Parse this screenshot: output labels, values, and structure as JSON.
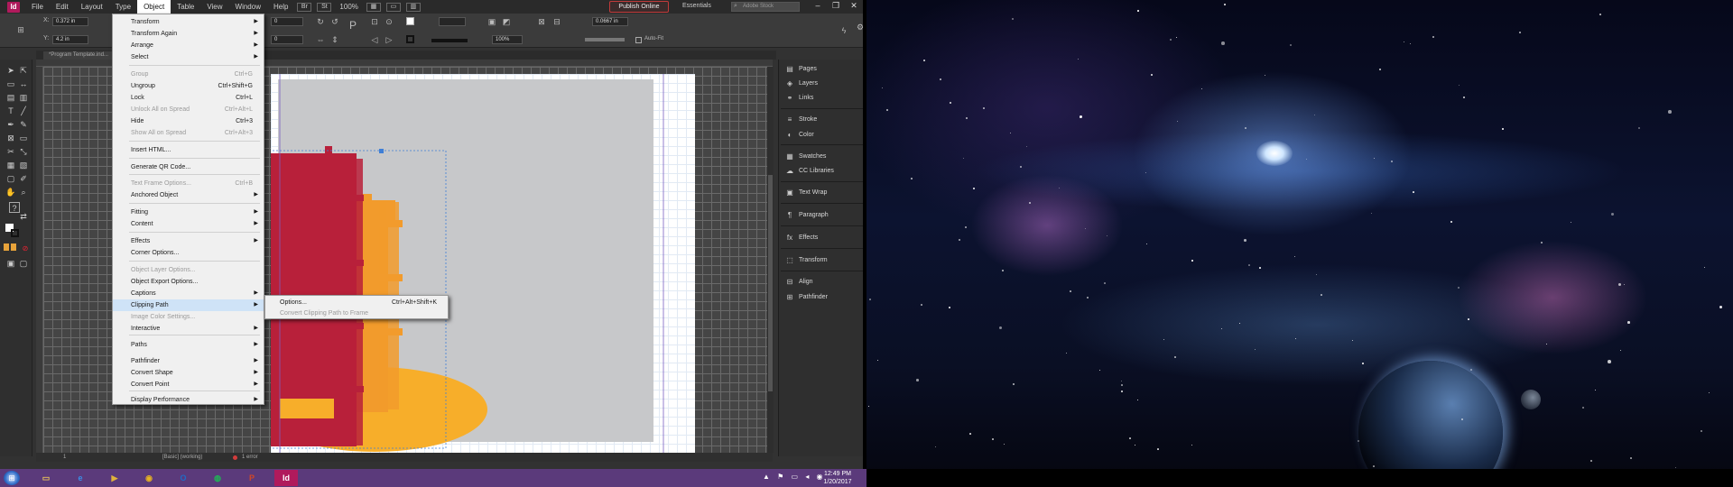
{
  "app": {
    "logo": "Id",
    "menus": [
      "File",
      "Edit",
      "Layout",
      "Type",
      "Object",
      "Table",
      "View",
      "Window",
      "Help"
    ],
    "active_menu": "Object",
    "zoom": "100%",
    "publish_label": "Publish Online",
    "workspace": "Essentials",
    "stock_search_placeholder": "Adobe Stock",
    "window_buttons": [
      "–",
      "❐",
      "✕"
    ]
  },
  "control_bar": {
    "x_value": "0.372 in",
    "y_value": "4.2 in",
    "w_value": "0",
    "h_value": "0",
    "stroke_weight": "0.0667 in",
    "percent": "100%",
    "auto_fit": "Auto-Fit"
  },
  "document_tab": {
    "title": "*Program Template.ind..."
  },
  "object_menu": {
    "items": [
      {
        "label": "Transform",
        "shortcut": "",
        "submenu": true,
        "disabled": false
      },
      {
        "label": "Transform Again",
        "shortcut": "",
        "submenu": true,
        "disabled": false
      },
      {
        "label": "Arrange",
        "shortcut": "",
        "submenu": true,
        "disabled": false
      },
      {
        "label": "Select",
        "shortcut": "",
        "submenu": true,
        "disabled": false
      },
      {
        "label": "Group",
        "shortcut": "Ctrl+G",
        "submenu": false,
        "disabled": true
      },
      {
        "label": "Ungroup",
        "shortcut": "Ctrl+Shift+G",
        "submenu": false,
        "disabled": false
      },
      {
        "label": "Lock",
        "shortcut": "Ctrl+L",
        "submenu": false,
        "disabled": false
      },
      {
        "label": "Unlock All on Spread",
        "shortcut": "Ctrl+Alt+L",
        "submenu": false,
        "disabled": true
      },
      {
        "label": "Hide",
        "shortcut": "Ctrl+3",
        "submenu": false,
        "disabled": false
      },
      {
        "label": "Show All on Spread",
        "shortcut": "Ctrl+Alt+3",
        "submenu": false,
        "disabled": true
      },
      {
        "label": "Insert HTML...",
        "shortcut": "",
        "submenu": false,
        "disabled": false
      },
      {
        "label": "Generate QR Code...",
        "shortcut": "",
        "submenu": false,
        "disabled": false
      },
      {
        "label": "Text Frame Options...",
        "shortcut": "Ctrl+B",
        "submenu": false,
        "disabled": true
      },
      {
        "label": "Anchored Object",
        "shortcut": "",
        "submenu": true,
        "disabled": false
      },
      {
        "label": "Fitting",
        "shortcut": "",
        "submenu": true,
        "disabled": false
      },
      {
        "label": "Content",
        "shortcut": "",
        "submenu": true,
        "disabled": false
      },
      {
        "label": "Effects",
        "shortcut": "",
        "submenu": true,
        "disabled": false
      },
      {
        "label": "Corner Options...",
        "shortcut": "",
        "submenu": false,
        "disabled": false
      },
      {
        "label": "Object Layer Options...",
        "shortcut": "",
        "submenu": false,
        "disabled": true
      },
      {
        "label": "Object Export Options...",
        "shortcut": "",
        "submenu": false,
        "disabled": false
      },
      {
        "label": "Captions",
        "shortcut": "",
        "submenu": true,
        "disabled": false
      },
      {
        "label": "Clipping Path",
        "shortcut": "",
        "submenu": true,
        "disabled": false
      },
      {
        "label": "Image Color Settings...",
        "shortcut": "",
        "submenu": false,
        "disabled": true
      },
      {
        "label": "Interactive",
        "shortcut": "",
        "submenu": true,
        "disabled": false
      },
      {
        "label": "Paths",
        "shortcut": "",
        "submenu": true,
        "disabled": false
      },
      {
        "label": "Pathfinder",
        "shortcut": "",
        "submenu": true,
        "disabled": false
      },
      {
        "label": "Convert Shape",
        "shortcut": "",
        "submenu": true,
        "disabled": false
      },
      {
        "label": "Convert Point",
        "shortcut": "",
        "submenu": true,
        "disabled": false
      },
      {
        "label": "Display Performance",
        "shortcut": "",
        "submenu": true,
        "disabled": false
      }
    ]
  },
  "clipping_submenu": {
    "items": [
      {
        "label": "Options...",
        "shortcut": "Ctrl+Alt+Shift+K",
        "disabled": false
      },
      {
        "label": "Convert Clipping Path to Frame",
        "shortcut": "",
        "disabled": true
      }
    ]
  },
  "panels": [
    {
      "label": "Pages",
      "icon": "pages-icon",
      "glyph": "▤"
    },
    {
      "label": "Layers",
      "icon": "layers-icon",
      "glyph": "◈"
    },
    {
      "label": "Links",
      "icon": "links-icon",
      "glyph": "⚭"
    },
    {
      "label": "Stroke",
      "icon": "stroke-icon",
      "glyph": "≡"
    },
    {
      "label": "Color",
      "icon": "color-icon",
      "glyph": "◐"
    },
    {
      "label": "Swatches",
      "icon": "swatches-icon",
      "glyph": "▦"
    },
    {
      "label": "CC Libraries",
      "icon": "cc-libraries-icon",
      "glyph": "☁"
    },
    {
      "label": "Text Wrap",
      "icon": "text-wrap-icon",
      "glyph": "▣"
    },
    {
      "label": "Paragraph",
      "icon": "paragraph-icon",
      "glyph": "¶"
    },
    {
      "label": "Effects",
      "icon": "effects-icon",
      "glyph": "fx"
    },
    {
      "label": "Transform",
      "icon": "transform-icon",
      "glyph": "⬚"
    },
    {
      "label": "Align",
      "icon": "align-icon",
      "glyph": "⊟"
    },
    {
      "label": "Pathfinder",
      "icon": "pathfinder-icon",
      "glyph": "⊞"
    }
  ],
  "status_bar": {
    "page": "1",
    "style": "[Basic] (working)",
    "errors": "1 error"
  },
  "taskbar": {
    "apps": [
      {
        "name": "file-explorer-icon",
        "glyph": "▭",
        "color": "#e8c15a"
      },
      {
        "name": "internet-explorer-icon",
        "glyph": "e",
        "color": "#3a8ee6"
      },
      {
        "name": "media-player-icon",
        "glyph": "▶",
        "color": "#e0b23c"
      },
      {
        "name": "chrome-icon",
        "glyph": "◉",
        "color": "#e6b323"
      },
      {
        "name": "outlook-icon",
        "glyph": "O",
        "color": "#1f6cc6"
      },
      {
        "name": "spotify-icon",
        "glyph": "◍",
        "color": "#1db954"
      },
      {
        "name": "powerpoint-icon",
        "glyph": "P",
        "color": "#d24726"
      },
      {
        "name": "indesign-icon",
        "glyph": "Id",
        "color": "#b01a5c"
      }
    ],
    "time": "12:49 PM",
    "date": "1/20/2017"
  },
  "colors": {
    "bookshelf_red": "#b8203a",
    "bookshelf_orange": "#f29b2c",
    "ellipse_yellow": "#f7ae2a",
    "accent_indesign": "#b01a5c"
  }
}
